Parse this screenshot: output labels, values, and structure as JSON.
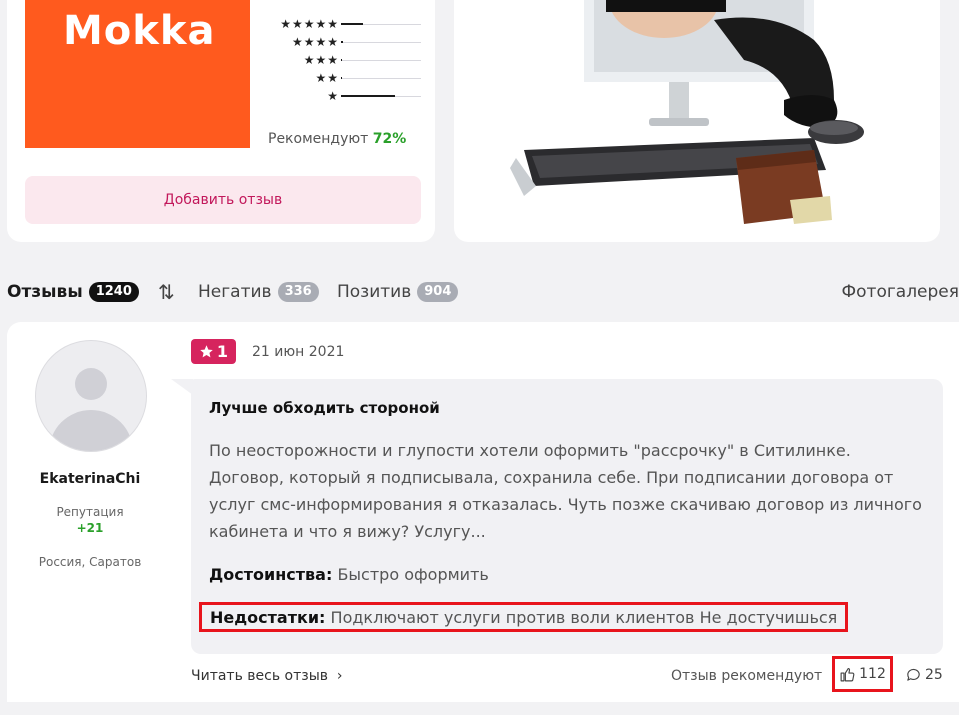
{
  "product": {
    "logo_text": "Mokka",
    "rating_distribution": [
      {
        "stars": "★★★★★",
        "share": 0.28
      },
      {
        "stars": "★★★★",
        "share": 0.03
      },
      {
        "stars": "★★★",
        "share": 0.01
      },
      {
        "stars": "★★",
        "share": 0.01
      },
      {
        "stars": "★",
        "share": 0.67
      }
    ],
    "recommend_label": "Рекомендуют",
    "recommend_value": "72%",
    "add_review_label": "Добавить отзыв"
  },
  "tabs": {
    "reviews_label": "Отзывы",
    "reviews_count": "1240",
    "sort_icon": "⇅",
    "negative_label": "Негатив",
    "negative_count": "336",
    "positive_label": "Позитив",
    "positive_count": "904",
    "gallery_label": "Фотогалерея"
  },
  "review": {
    "author": "EkaterinaChi",
    "reputation_label": "Репутация",
    "reputation_value": "+21",
    "location": "Россия, Саратов",
    "rating": "1",
    "date": "21 июн 2021",
    "title": "Лучше обходить стороной",
    "text": "По неосторожности и глупости хотели оформить \"рассрочку\" в Ситилинке. Договор, который я подписывала, сохранила себе. При подписании договора от услуг смс-информирования я отказалась. Чуть позже скачиваю договор из личного кабинета и что я вижу? Услугу...",
    "pros_label": "Достоинства:",
    "pros_text": "Быстро оформить",
    "cons_label": "Недостатки:",
    "cons_text": "Подключают услуги против воли клиентов Не достучишься",
    "read_full_label": "Читать весь отзыв",
    "recommends_label": "Отзыв рекомендуют",
    "likes": "112",
    "comments": "25"
  },
  "colors": {
    "brand_orange": "#ff5a1e",
    "accent_pink": "#d6245e",
    "positive_green": "#2aa02a",
    "highlight_red": "#e8141c"
  }
}
